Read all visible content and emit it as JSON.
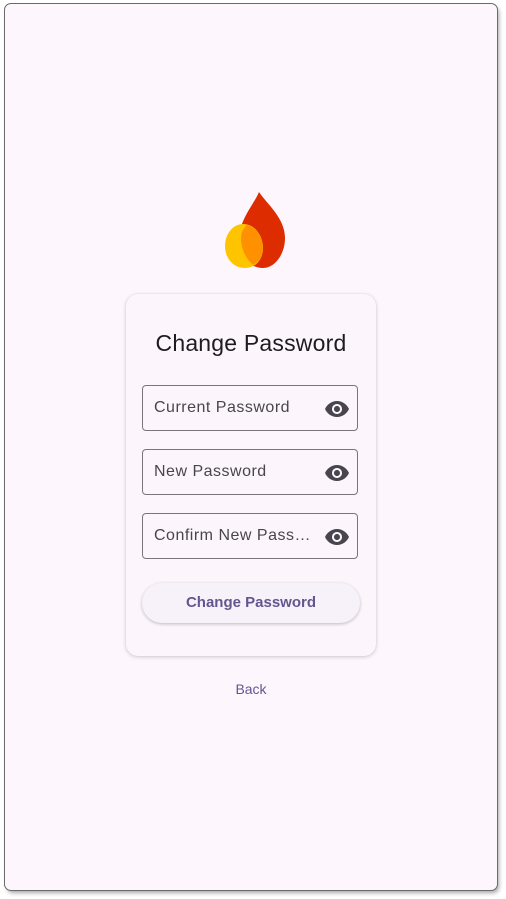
{
  "app": {
    "logo_icon": "flame-logo-icon",
    "colors": {
      "background": "#fdf7fd",
      "primary": "#65558f",
      "flame_red": "#dd2c00",
      "flame_orange": "#ff6d00",
      "flame_yellow": "#ffc400"
    }
  },
  "card": {
    "title": "Change Password",
    "fields": [
      {
        "label": "Current Password",
        "icon": "eye-icon"
      },
      {
        "label": "New Password",
        "icon": "eye-icon"
      },
      {
        "label": "Confirm New Password",
        "icon": "eye-icon"
      }
    ],
    "submit_label": "Change Password"
  },
  "footer": {
    "back_label": "Back"
  }
}
